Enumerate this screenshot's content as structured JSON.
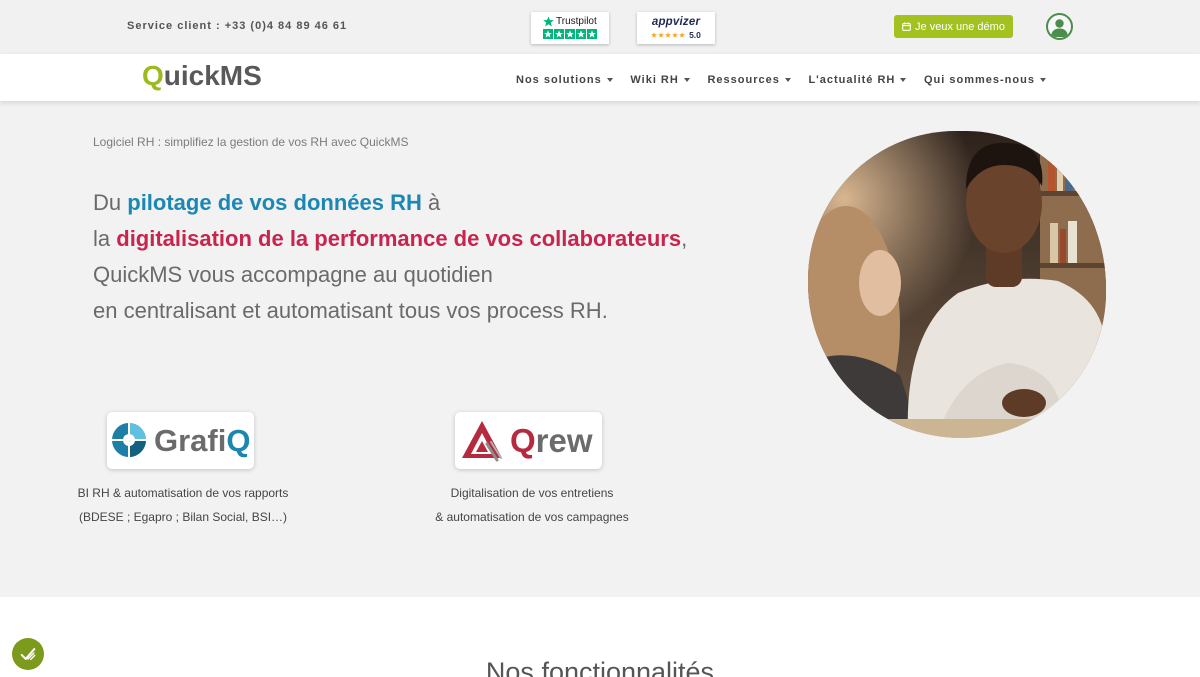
{
  "topbar": {
    "service_client": "Service client : +33 (0)4 84 89 46 61",
    "trustpilot": {
      "label": "Trustpilot",
      "stars": 5,
      "logo_icon": "trustpilot-star-icon"
    },
    "appvizer": {
      "label": "appvizer",
      "stars": 5,
      "rating": "5.0"
    },
    "demo_button": {
      "label": "Je veux une démo",
      "icon": "calendar-icon"
    },
    "account": {
      "icon": "user-icon"
    }
  },
  "nav": {
    "logo": {
      "accent": "Q",
      "rest": "uickMS"
    },
    "items": [
      {
        "label": "Nos solutions",
        "icon": "caret-down-icon"
      },
      {
        "label": "Wiki RH",
        "icon": "caret-down-icon"
      },
      {
        "label": "Ressources",
        "icon": "caret-down-icon"
      },
      {
        "label": "L'actualité RH",
        "icon": "caret-down-icon"
      },
      {
        "label": "Qui sommes-nous",
        "icon": "caret-down-icon"
      }
    ]
  },
  "hero": {
    "kicker": "Logiciel RH : simplifiez la gestion de vos RH avec QuickMS",
    "headline": {
      "line1": {
        "before": "Du ",
        "highlight": "pilotage de vos données RH",
        "after": " à"
      },
      "line2": {
        "before": "la ",
        "highlight": "digitalisation de la performance de vos collaborateurs",
        "after": ","
      },
      "line3": "QuickMS vous accompagne au quotidien",
      "line4": "en centralisant et automatisant tous vos process RH."
    }
  },
  "products": [
    {
      "logo_main": "Grafi",
      "logo_accent": "Q",
      "icon": "grafiq-logo-icon",
      "caption_line1": "BI RH & automatisation de vos rapports",
      "caption_line2": "(BDESE ; Egapro ; Bilan Social, BSI…)"
    },
    {
      "logo_accent": "Q",
      "logo_main": "rew",
      "icon": "qrew-logo-icon",
      "caption_line1": "Digitalisation de vos entretiens",
      "caption_line2": "& automatisation de vos campagnes"
    }
  ],
  "features": {
    "title": "Nos fonctionnalités"
  },
  "cookie_badge": {
    "icon": "cookie-consent-icon"
  },
  "colors": {
    "brand_lime": "#a3c11f",
    "accent_blue": "#1b87b4",
    "accent_crimson": "#c7254e",
    "trustpilot_green": "#00b67a",
    "trustpilot_star": "#ffffff",
    "appvizer_star": "#f5a623",
    "account_green": "#4b8d4b",
    "cookie_green": "#7c9a1b",
    "hero_background": "#f2f2f2"
  }
}
